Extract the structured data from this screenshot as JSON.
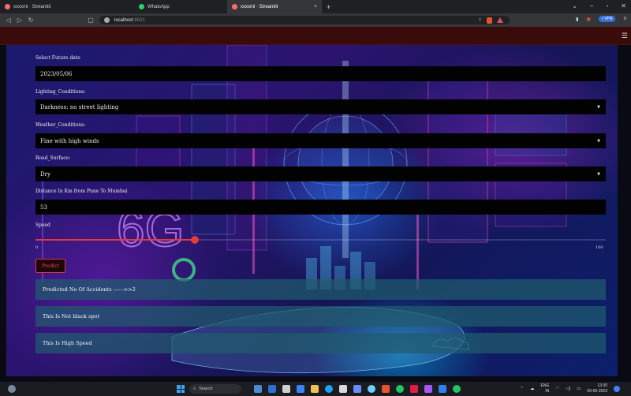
{
  "browser": {
    "tabs": [
      {
        "label": "xxxxml · Streamlit",
        "favicon": "streamlit-icon",
        "active": false
      },
      {
        "label": "WhatsApp",
        "favicon": "whatsapp-icon",
        "active": false
      },
      {
        "label": "xxxxml · Streamlit",
        "favicon": "streamlit-icon",
        "active": true
      }
    ],
    "new_tab_symbol": "+",
    "url_host": "localhost",
    "url_port": ":8501",
    "vpn_label": "• VPN"
  },
  "form": {
    "date_label": "Select Future date",
    "date_value": "2023/05/06",
    "lighting_label": "Lighting_Conditions:",
    "lighting_value": "Darkness: no street lighting",
    "weather_label": "Weather_Conditions:",
    "weather_value": "Fine with high winds",
    "road_label": "Road_Surface:",
    "road_value": "Dry",
    "distance_label": "Distance In Km from Pune To Mumbai",
    "distance_value": "53",
    "speed_label": "Speed",
    "speed_min": "0",
    "speed_max": "100",
    "speed_fraction": 0.28,
    "predict_label": "Predict"
  },
  "results": [
    "Predicted No Of Accidents ------>>2",
    "This Is Not black spot",
    "This Is High Speed"
  ],
  "taskbar": {
    "search_label": "Search",
    "lang_line1": "ENG",
    "lang_line2": "IN",
    "time": "13:30",
    "date": "06-05-2023"
  },
  "colors": {
    "accent_red": "#e23b3b",
    "result_bg": "#205c6e"
  }
}
